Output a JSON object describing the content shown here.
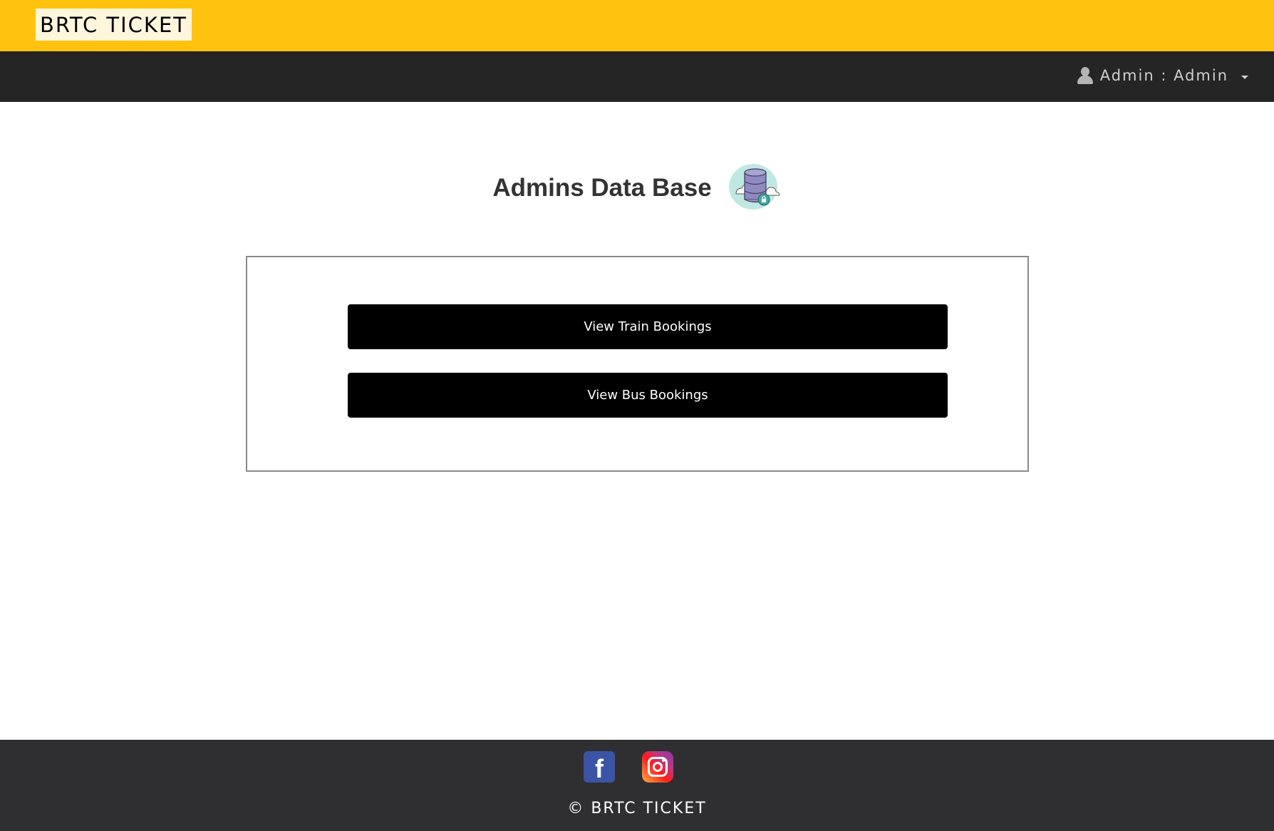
{
  "header": {
    "brand": "BRTC TICKET",
    "brand_bg": "#fff6dc",
    "bar_color": "#ffc20e"
  },
  "navbar": {
    "bg_color": "#252525",
    "user_menu": {
      "icon": "user-icon",
      "label": "Admin : Admin",
      "dropdown_icon": "caret-down-icon"
    }
  },
  "main": {
    "title": "Admins Data Base",
    "title_icon": "database-cloud-icon",
    "buttons": {
      "train": "View Train Bookings",
      "bus": "View Bus Bookings"
    },
    "button_color": "#000000"
  },
  "footer": {
    "bg_color": "#2f2f31",
    "social": [
      {
        "name": "facebook",
        "icon": "facebook-icon",
        "color": "#3b54a6"
      },
      {
        "name": "instagram",
        "icon": "instagram-icon"
      }
    ],
    "copyright": "© BRTC TICKET"
  }
}
